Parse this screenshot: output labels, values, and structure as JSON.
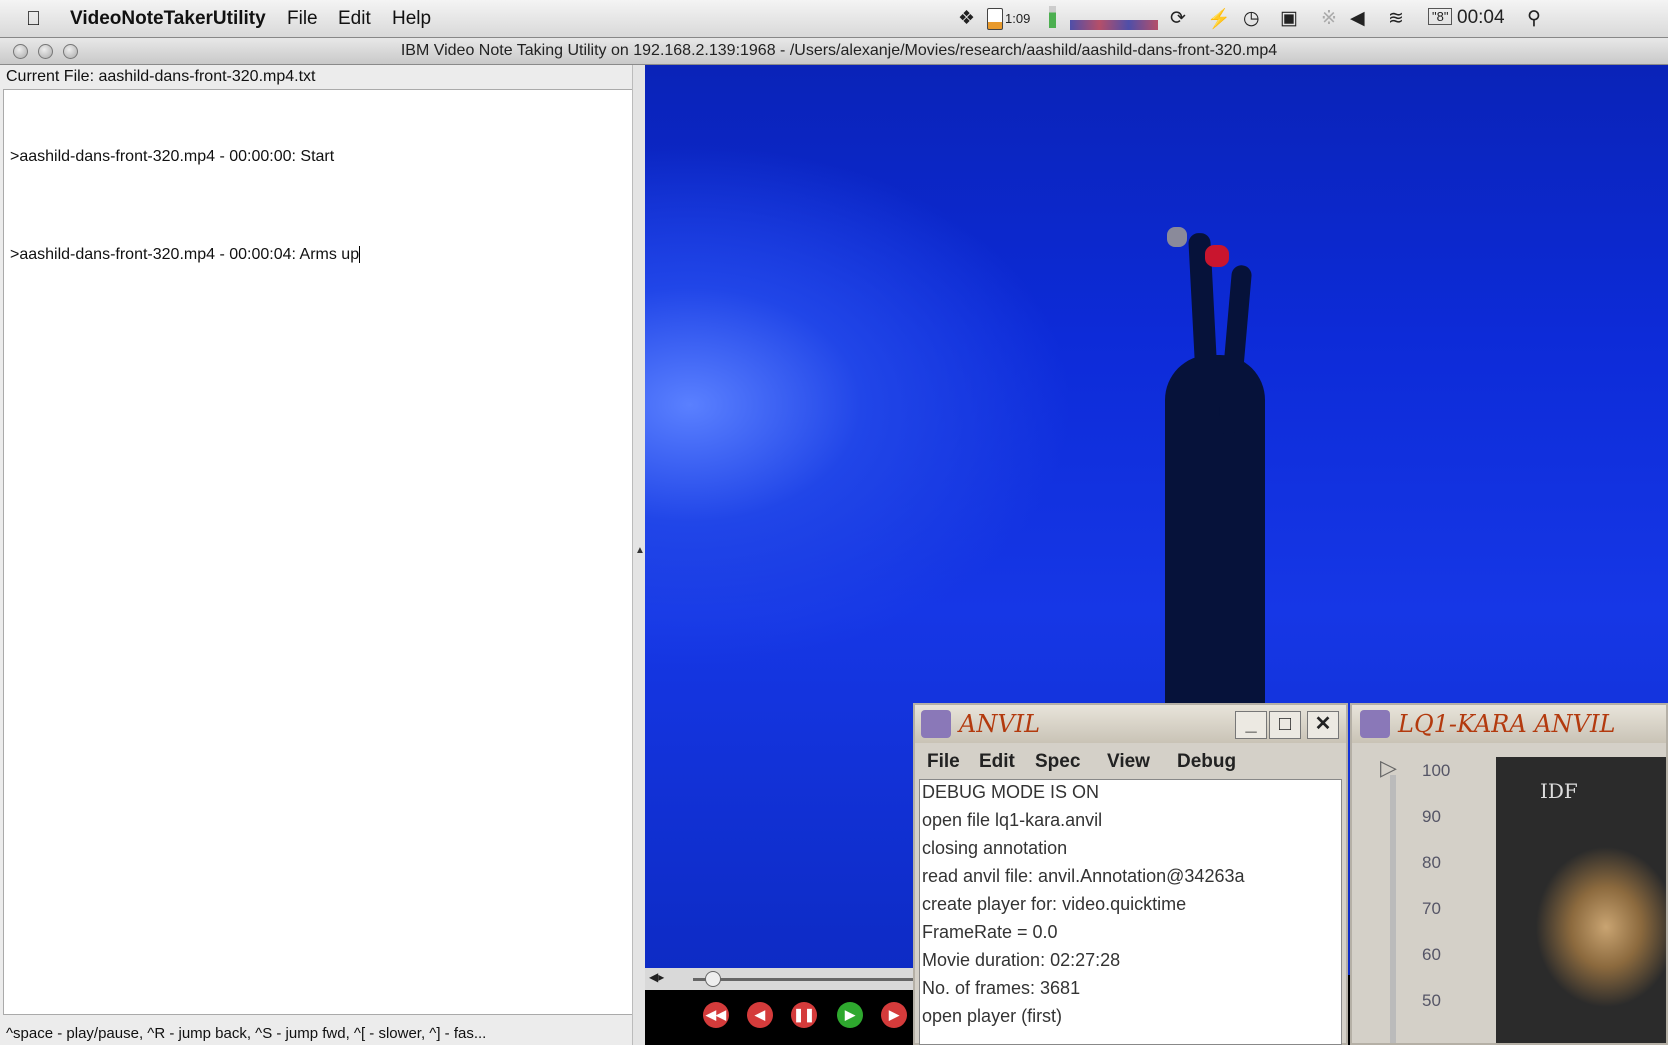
{
  "menubar": {
    "app_name": "VideoNoteTakerUtility",
    "menus": [
      "File",
      "Edit",
      "Help"
    ],
    "battery_time": "1:09",
    "clock": "00:04",
    "input_source": "\"8\""
  },
  "window": {
    "title": "IBM Video Note Taking Utility  on 192.168.2.139:1968 - /Users/alexanje/Movies/research/aashild/aashild-dans-front-320.mp4"
  },
  "notes_pane": {
    "current_file": "Current File: aashild-dans-front-320.mp4.txt",
    "notes": [
      ">aashild-dans-front-320.mp4 - 00:00:00: Start",
      ">aashild-dans-front-320.mp4 - 00:00:04: Arms up"
    ],
    "status": "^space - play/pause, ^R - jump back, ^S - jump fwd, ^[ - slower, ^] - fas..."
  },
  "anvil_window": {
    "title": "ANVIL",
    "menus": [
      "File",
      "Edit",
      "Spec",
      "View",
      "Debug"
    ],
    "log": [
      "DEBUG MODE IS ON",
      "open file lq1-kara.anvil",
      "closing annotation",
      "read anvil file: anvil.Annotation@34263a",
      "create player for: video.quicktime",
      "FrameRate = 0.0",
      "Movie duration: 02:27:28",
      "No. of frames: 3681",
      "open player (first)"
    ]
  },
  "second_window": {
    "title": "LQ1-KARA ANVIL",
    "ruler_ticks": [
      "100",
      "90",
      "80",
      "70",
      "60",
      "50"
    ],
    "thumbnail_label": "IDF"
  }
}
